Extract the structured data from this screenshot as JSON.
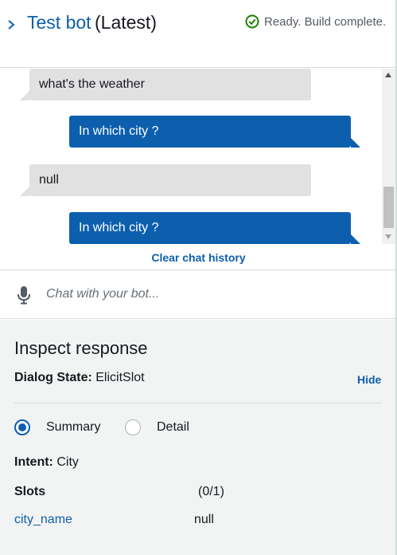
{
  "header": {
    "title": "Test bot",
    "version": "(Latest)",
    "status": "Ready. Build complete.",
    "status_color": "#1d8102",
    "accent_color": "#0d5fae",
    "expand_icon": "chevron-right-icon",
    "status_icon": "check-circle-icon"
  },
  "chat": {
    "messages": [
      {
        "from": "user",
        "text": "what's the weather"
      },
      {
        "from": "bot",
        "text": "In which city ?"
      },
      {
        "from": "user",
        "text": "null"
      },
      {
        "from": "bot",
        "text": "In which city ?"
      }
    ],
    "clear_label": "Clear chat history",
    "input_placeholder": "Chat with your bot...",
    "mic_icon": "microphone-icon"
  },
  "inspect": {
    "title": "Inspect response",
    "dialog_state_label": "Dialog State:",
    "dialog_state_value": "ElicitSlot",
    "hide_label": "Hide",
    "view_options": [
      {
        "label": "Summary",
        "selected": true
      },
      {
        "label": "Detail",
        "selected": false
      }
    ],
    "intent_label": "Intent:",
    "intent_value": "City",
    "slots_label": "Slots",
    "slots_count": "(0/1)",
    "slots": [
      {
        "name": "city_name",
        "value": "null"
      }
    ]
  }
}
